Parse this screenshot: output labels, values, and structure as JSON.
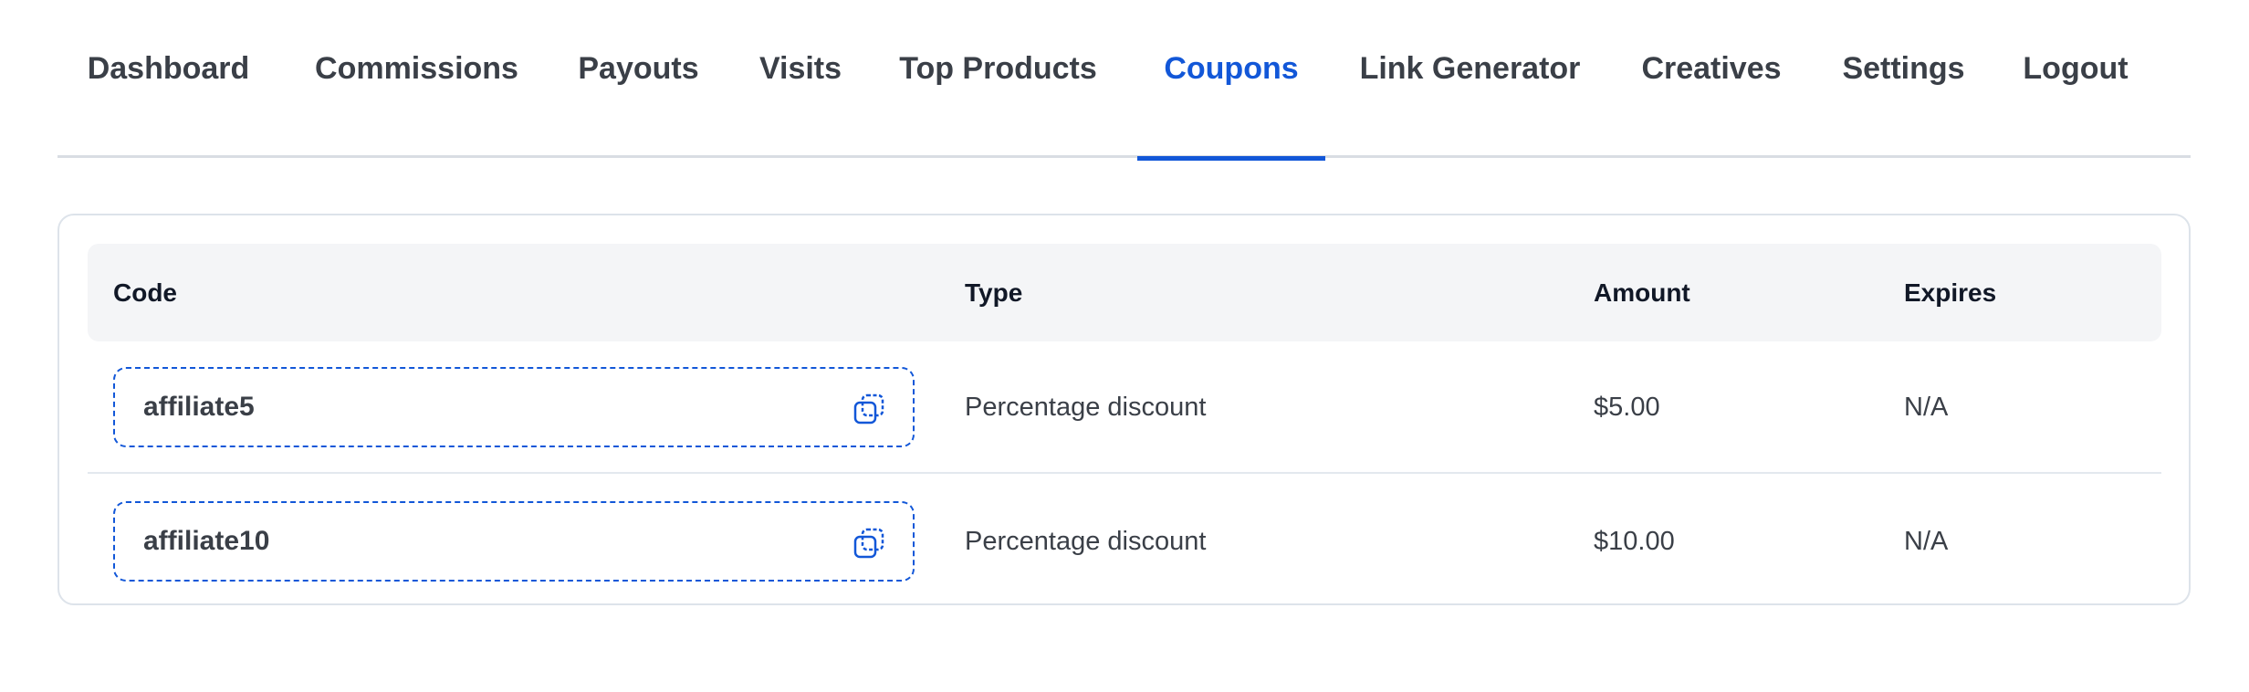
{
  "tabs": [
    {
      "label": "Dashboard"
    },
    {
      "label": "Commissions"
    },
    {
      "label": "Payouts"
    },
    {
      "label": "Visits"
    },
    {
      "label": "Top Products"
    },
    {
      "label": "Coupons",
      "active": true
    },
    {
      "label": "Link Generator"
    },
    {
      "label": "Creatives"
    },
    {
      "label": "Settings"
    },
    {
      "label": "Logout"
    }
  ],
  "table": {
    "headers": {
      "code": "Code",
      "type": "Type",
      "amount": "Amount",
      "expires": "Expires"
    },
    "rows": [
      {
        "code": "affiliate5",
        "type": "Percentage discount",
        "amount": "$5.00",
        "expires": "N/A"
      },
      {
        "code": "affiliate10",
        "type": "Percentage discount",
        "amount": "$10.00",
        "expires": "N/A"
      }
    ]
  },
  "colors": {
    "accent": "#1257d8",
    "text": "#3a3f47",
    "header_bg": "#f4f5f7"
  },
  "icons": {
    "copy": "copy-icon"
  }
}
